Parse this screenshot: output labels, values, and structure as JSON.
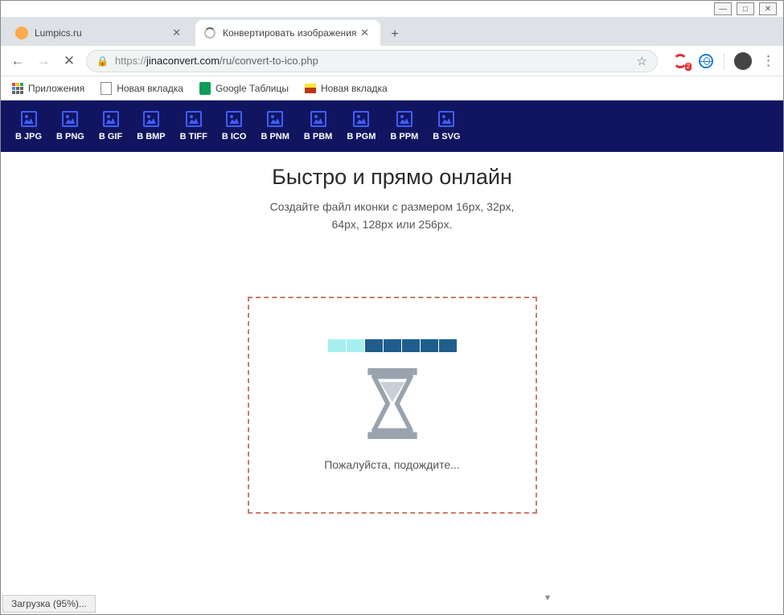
{
  "window": {
    "min": "—",
    "max": "□",
    "close": "✕"
  },
  "tabs": [
    {
      "title": "Lumpics.ru",
      "active": false
    },
    {
      "title": "Конвертировать изображения",
      "active": true
    }
  ],
  "newtab": "+",
  "address": {
    "proto": "https://",
    "host": "jinaconvert.com",
    "path": "/ru/convert-to-ico.php"
  },
  "ext_badge": "2",
  "bookmarks": [
    {
      "label": "Приложения"
    },
    {
      "label": "Новая вкладка"
    },
    {
      "label": "Google Таблицы"
    },
    {
      "label": "Новая вкладка"
    }
  ],
  "formats": [
    "B JPG",
    "B PNG",
    "B GIF",
    "B BMP",
    "B TIFF",
    "B ICO",
    "B PNM",
    "B PBM",
    "B PGM",
    "B PPM",
    "B SVG"
  ],
  "page": {
    "headline": "Быстро и прямо онлайн",
    "sub1": "Создайте файл иконки с размером 16px, 32px,",
    "sub2": "64px, 128px или 256px.",
    "wait": "Пожалуйста, подождите..."
  },
  "status": "Загрузка (95%)...",
  "progress_blocks": [
    "light",
    "light",
    "dark",
    "dark",
    "dark",
    "dark",
    "dark"
  ]
}
